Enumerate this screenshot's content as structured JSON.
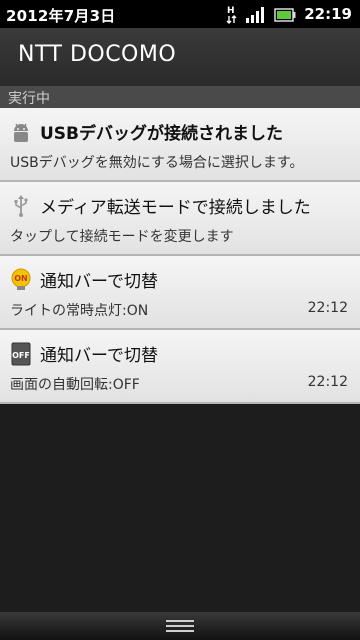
{
  "status_bar": {
    "date": "2012年7月3日",
    "time": "22:19",
    "network_icon": "hspa-icon",
    "signal_icon": "signal-icon",
    "battery_icon": "battery-icon"
  },
  "header": {
    "carrier": "NTT DOCOMO"
  },
  "section": {
    "label": "実行中"
  },
  "notifications": [
    {
      "icon": "android-debug-icon",
      "title": "USBデバッグが接続されました",
      "text": "USBデバッグを無効にする場合に選択します。",
      "time": ""
    },
    {
      "icon": "usb-icon",
      "title": "メディア転送モードで接続しました",
      "text": "タップして接続モードを変更します",
      "time": ""
    },
    {
      "icon": "light-on-icon",
      "icon_text": "ON",
      "title": "通知バーで切替",
      "text": "ライトの常時点灯:ON",
      "time": "22:12"
    },
    {
      "icon": "rotation-off-icon",
      "icon_text": "OFF",
      "title": "通知バーで切替",
      "text": "画面の自動回転:OFF",
      "time": "22:12"
    }
  ],
  "colors": {
    "status_bar_bg": "#000000",
    "list_bg": "#ededed",
    "battery": "#5fc83c"
  }
}
